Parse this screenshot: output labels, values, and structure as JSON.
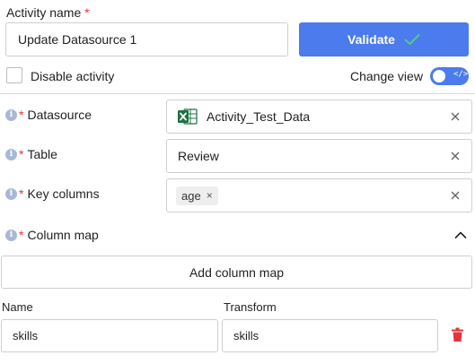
{
  "activity": {
    "name_label": "Activity name",
    "required_mark": "*",
    "name_value": "Update Datasource 1"
  },
  "validate": {
    "label": "Validate",
    "icon": "check-icon",
    "color": "#4b7bec"
  },
  "disable": {
    "label": "Disable activity",
    "checked": false
  },
  "change_view": {
    "label": "Change view",
    "toggle_on": true,
    "toggle_glyph": "</>"
  },
  "fields": {
    "required_mark": "*",
    "datasource": {
      "label": "Datasource",
      "value": "Activity_Test_Data",
      "icon": "excel-icon"
    },
    "table": {
      "label": "Table",
      "value": "Review"
    },
    "key_columns": {
      "label": "Key columns",
      "chips": [
        "age"
      ],
      "chip_remove": "×"
    },
    "column_map": {
      "label": "Column map",
      "expanded": true
    }
  },
  "add_column_map": {
    "label": "Add column map"
  },
  "mapping": {
    "headers": {
      "name": "Name",
      "transform": "Transform"
    },
    "rows": [
      {
        "name": "skills",
        "transform": "skills"
      }
    ]
  },
  "colors": {
    "accent": "#4b7bec",
    "required": "#e5333a",
    "delete": "#e5333a",
    "excel": "#1f7244"
  }
}
